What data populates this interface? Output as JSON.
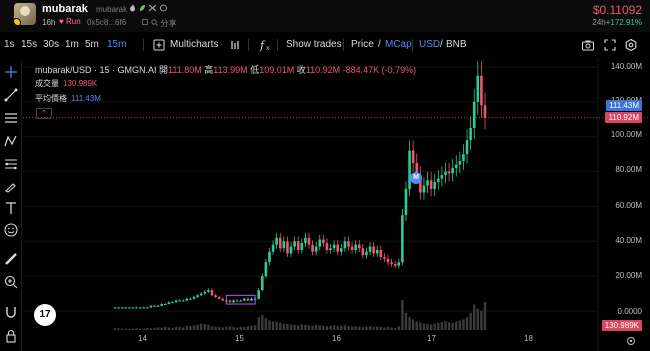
{
  "header": {
    "token_name": "mubarak",
    "token_subname": "mubarak",
    "age": "16h",
    "run_label": "Run",
    "address": "0x5c8...6f6",
    "share_label": "分享",
    "price": "$0.11092",
    "change_period": "24h",
    "change_value": "+172.91%",
    "icons": [
      "flame-icon",
      "leaf-icon",
      "twitter-icon",
      "web-icon",
      "search-icon"
    ]
  },
  "toolbar": {
    "intervals": [
      "1s",
      "15s",
      "30s",
      "1m",
      "5m",
      "15m"
    ],
    "active_interval": "15m",
    "multicharts": "Multicharts",
    "show_trades": "Show trades",
    "price_label": "Price",
    "mcap_label": "MCap",
    "usd_label": "USD",
    "bnb_label": "BNB",
    "slash": "/"
  },
  "legend": {
    "pair": "mubarak/USD · 15 · GMGN.AI",
    "open_label": "開",
    "open": "111.80M",
    "high_label": "高",
    "high": "113.99M",
    "low_label": "低",
    "low": "109.01M",
    "close_label": "收",
    "close": "110.92M",
    "change": "-884.47K (-0.79%)",
    "volume_label": "成交量",
    "volume": "130.989K",
    "avg_label": "平均價格",
    "avg": "111.43M"
  },
  "chart_data": {
    "type": "candlestick",
    "x_ticks": [
      "14",
      "15",
      "16",
      "17",
      "18"
    ],
    "y_ticks": [
      "140.00M",
      "120.00M",
      "100.00M",
      "80.00M",
      "60.00M",
      "40.00M",
      "20.00M",
      "0.0000"
    ],
    "ylim": [
      0,
      140000000
    ],
    "price_tags": {
      "avg": "111.43M",
      "close": "110.92M",
      "volume": "130.989K"
    },
    "marker_label": "M",
    "close_series_M": [
      2,
      2,
      2,
      2,
      2,
      2,
      2,
      2,
      2,
      2,
      3,
      3,
      3,
      4,
      4,
      5,
      5,
      6,
      6,
      6,
      7,
      7,
      8,
      9,
      10,
      11,
      12,
      9,
      8,
      7,
      6,
      6,
      5,
      6,
      6,
      6,
      7,
      6,
      7,
      7,
      12,
      20,
      28,
      34,
      38,
      42,
      36,
      40,
      33,
      37,
      40,
      35,
      39,
      42,
      38,
      34,
      37,
      41,
      39,
      35,
      36,
      38,
      34,
      36,
      40,
      37,
      35,
      38,
      36,
      32,
      34,
      37,
      33,
      35,
      31,
      30,
      28,
      27,
      26,
      28,
      55,
      70,
      92,
      85,
      78,
      68,
      72,
      75,
      70,
      74,
      76,
      78,
      80,
      79,
      82,
      84,
      86,
      90,
      98,
      105,
      120,
      135,
      118,
      110.92
    ],
    "volume_series_K": [
      10,
      8,
      6,
      7,
      5,
      6,
      8,
      7,
      6,
      9,
      8,
      10,
      12,
      11,
      14,
      12,
      10,
      15,
      14,
      12,
      20,
      18,
      22,
      25,
      30,
      28,
      24,
      18,
      16,
      14,
      12,
      15,
      18,
      14,
      12,
      16,
      14,
      18,
      20,
      22,
      60,
      70,
      55,
      45,
      40,
      38,
      35,
      30,
      28,
      26,
      24,
      22,
      26,
      24,
      22,
      20,
      24,
      22,
      20,
      18,
      20,
      22,
      18,
      20,
      22,
      18,
      16,
      18,
      16,
      14,
      16,
      18,
      14,
      16,
      14,
      12,
      14,
      12,
      10,
      18,
      140,
      80,
      60,
      50,
      40,
      35,
      30,
      28,
      26,
      30,
      34,
      38,
      42,
      36,
      34,
      40,
      44,
      50,
      60,
      80,
      120,
      100,
      90,
      130.989
    ]
  }
}
